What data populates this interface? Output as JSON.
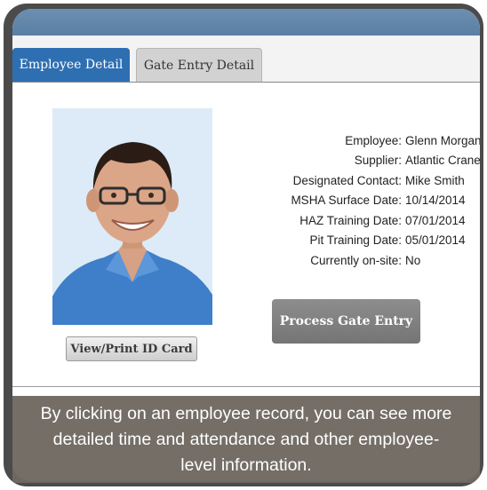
{
  "tabs": [
    {
      "label": "Employee Detail",
      "active": true
    },
    {
      "label": "Gate Entry Detail",
      "active": false
    }
  ],
  "employee": {
    "rows": [
      {
        "label": "Employee:",
        "value": "Glenn Morgan"
      },
      {
        "label": "Supplier:",
        "value": "Atlantic Crane"
      },
      {
        "label": "Designated Contact:",
        "value": "Mike Smith"
      },
      {
        "label": "MSHA Surface Date:",
        "value": "10/14/2014"
      },
      {
        "label": "HAZ Training Date:",
        "value": "07/01/2014"
      },
      {
        "label": "Pit Training Date:",
        "value": "05/01/2014"
      },
      {
        "label": "Currently on-site:",
        "value": "No"
      }
    ]
  },
  "buttons": {
    "view_print_id": "View/Print ID Card",
    "process_gate_entry": "Process Gate Entry"
  },
  "caption": "By clicking on an employee record, you can see more detailed time and attendance and other employee-level information.",
  "colors": {
    "active_tab": "#2e6fb2",
    "titlebar": "#5f83a7",
    "frame": "#4b4b4b",
    "caption_bg": "#6e6861"
  }
}
